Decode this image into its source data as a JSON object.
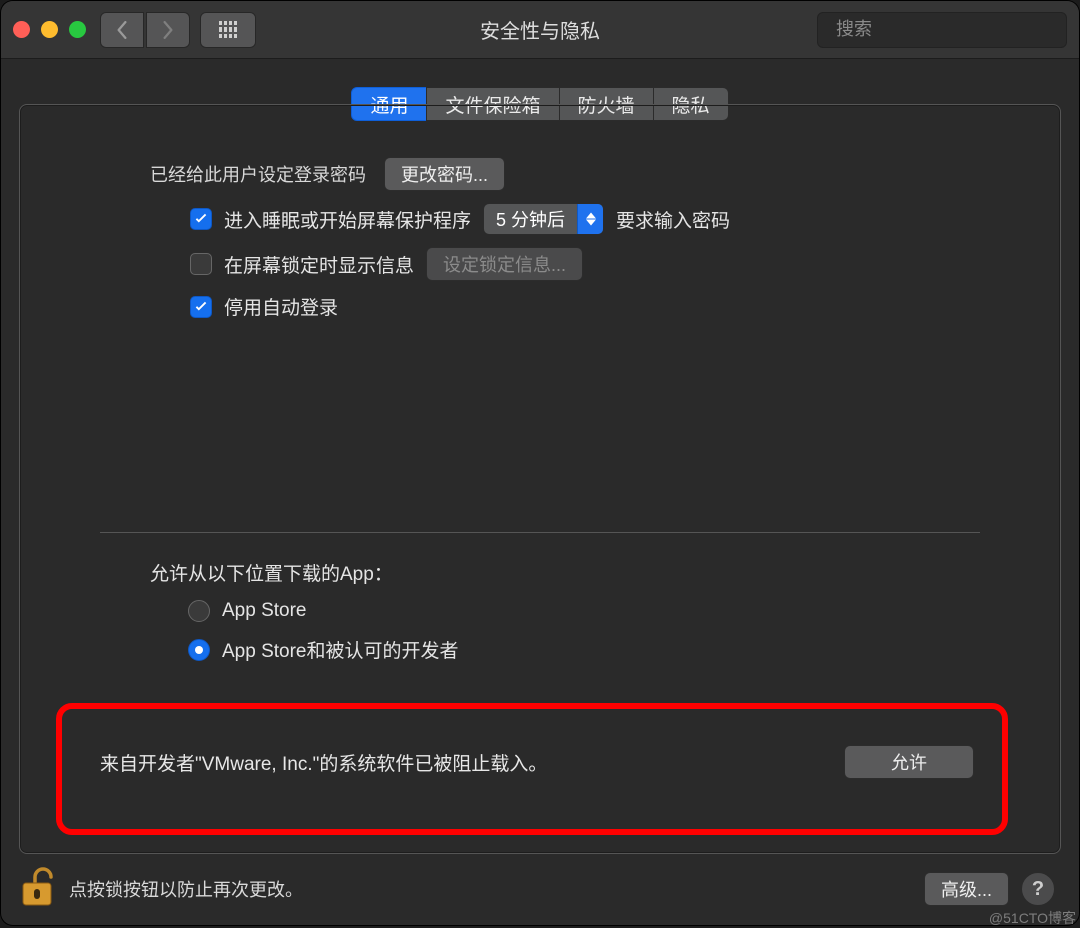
{
  "window": {
    "title": "安全性与隐私"
  },
  "toolbar": {
    "search_placeholder": "搜索"
  },
  "tabs": {
    "general": "通用",
    "filevault": "文件保险箱",
    "firewall": "防火墙",
    "privacy": "隐私"
  },
  "login": {
    "password_set_label": "已经给此用户设定登录密码",
    "change_password_btn": "更改密码...",
    "require_password": {
      "checked": true,
      "prefix": "进入睡眠或开始屏幕保护程序",
      "select_value": "5 分钟后",
      "suffix": "要求输入密码"
    },
    "show_message": {
      "checked": false,
      "label": "在屏幕锁定时显示信息",
      "set_message_btn": "设定锁定信息..."
    },
    "disable_auto_login": {
      "checked": true,
      "label": "停用自动登录"
    }
  },
  "allow_apps": {
    "title": "允许从以下位置下载的App：",
    "options": {
      "app_store": {
        "label": "App Store",
        "selected": false
      },
      "identified": {
        "label": "App Store和被认可的开发者",
        "selected": true
      }
    }
  },
  "blocked": {
    "message": "来自开发者\"VMware, Inc.\"的系统软件已被阻止载入。",
    "allow_btn": "允许"
  },
  "footer": {
    "lock_hint": "点按锁按钮以防止再次更改。",
    "advanced_btn": "高级...",
    "help_label": "?"
  },
  "watermark": "@51CTO博客"
}
